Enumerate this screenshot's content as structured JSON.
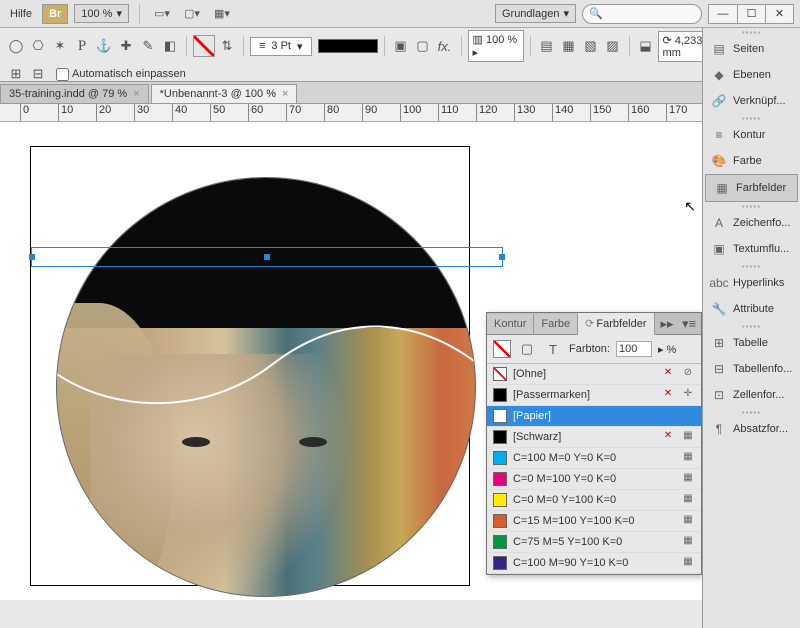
{
  "topbar": {
    "help": "Hilfe",
    "br": "Br",
    "zoom": "100 %",
    "workspace": "Grundlagen",
    "search_placeholder": ""
  },
  "toolbar": {
    "stroke_pt": "3 Pt",
    "fill_pct": "100 %",
    "dim": "4,233 mm",
    "autofit": "Automatisch einpassen"
  },
  "tabs": [
    {
      "label": "35-training.indd @ 79 %",
      "active": false
    },
    {
      "label": "*Unbenannt-3 @ 100 %",
      "active": true
    }
  ],
  "ruler": {
    "marks": [
      "0",
      "10",
      "20",
      "30",
      "40",
      "50",
      "60",
      "70",
      "80",
      "90",
      "100",
      "110",
      "120",
      "130",
      "140",
      "150",
      "160",
      "170"
    ]
  },
  "swatch_panel": {
    "tabs": {
      "kontur": "Kontur",
      "farbe": "Farbe",
      "farbfelder": "Farbfelder"
    },
    "tint_label": "Farbton:",
    "tint_value": "100",
    "tint_pct": "%",
    "rows": [
      {
        "chip": "none",
        "name": "[Ohne]",
        "i1": "x",
        "i2": "no"
      },
      {
        "chip": "#000",
        "name": "[Passermarken]",
        "i1": "x",
        "i2": "reg"
      },
      {
        "chip": "#fff",
        "name": "[Papier]",
        "sel": true
      },
      {
        "chip": "#000",
        "name": "[Schwarz]",
        "i1": "x",
        "i2": "cmyk"
      },
      {
        "chip": "#00aef0",
        "name": "C=100 M=0 Y=0 K=0",
        "i2": "cmyk"
      },
      {
        "chip": "#e6007e",
        "name": "C=0 M=100 Y=0 K=0",
        "i2": "cmyk"
      },
      {
        "chip": "#ffed00",
        "name": "C=0 M=0 Y=100 K=0",
        "i2": "cmyk"
      },
      {
        "chip": "#d85c2c",
        "name": "C=15 M=100 Y=100 K=0",
        "i2": "cmyk"
      },
      {
        "chip": "#009640",
        "name": "C=75 M=5 Y=100 K=0",
        "i2": "cmyk"
      },
      {
        "chip": "#312783",
        "name": "C=100 M=90 Y=10 K=0",
        "i2": "cmyk"
      }
    ]
  },
  "rail": {
    "items": [
      {
        "icon": "pages",
        "label": "Seiten"
      },
      {
        "icon": "layers",
        "label": "Ebenen"
      },
      {
        "icon": "links",
        "label": "Verknüpf..."
      },
      {
        "icon": "stroke",
        "label": "Kontur"
      },
      {
        "icon": "color",
        "label": "Farbe"
      },
      {
        "icon": "swatches",
        "label": "Farbfelder",
        "active": true
      },
      {
        "icon": "char",
        "label": "Zeichenfo..."
      },
      {
        "icon": "wrap",
        "label": "Textumflu..."
      },
      {
        "icon": "hyper",
        "label": "Hyperlinks"
      },
      {
        "icon": "attr",
        "label": "Attribute"
      },
      {
        "icon": "table",
        "label": "Tabelle"
      },
      {
        "icon": "tablef",
        "label": "Tabellenfo..."
      },
      {
        "icon": "cellf",
        "label": "Zellenfor..."
      },
      {
        "icon": "para",
        "label": "Absatzfor..."
      }
    ]
  }
}
